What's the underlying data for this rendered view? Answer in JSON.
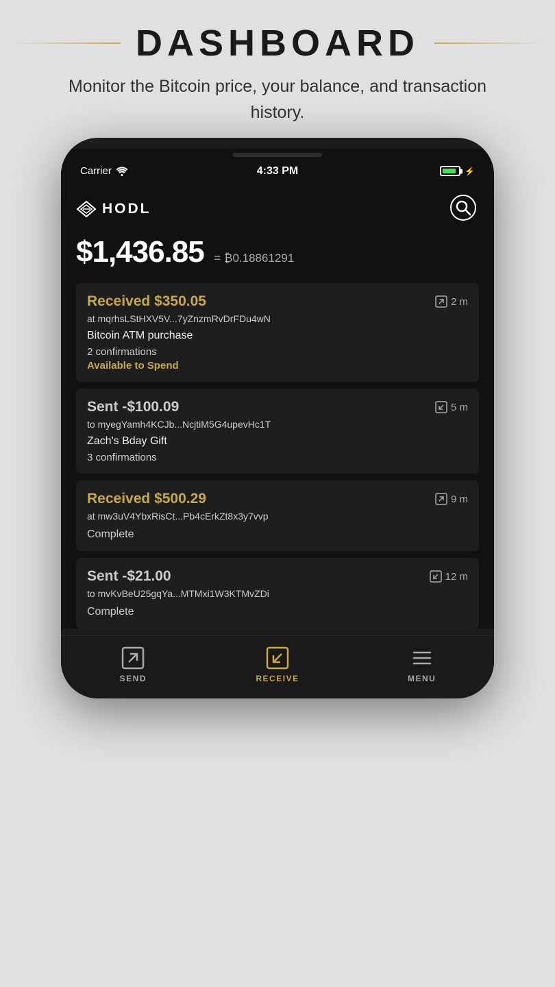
{
  "header": {
    "title": "DASHBOARD",
    "subtitle": "Monitor the Bitcoin price, your balance, and transaction history."
  },
  "phone": {
    "status_bar": {
      "carrier": "Carrier",
      "time": "4:33 PM",
      "battery_icon": "battery"
    },
    "app": {
      "logo_text": "HODL",
      "balance_usd": "$1,436.85",
      "balance_btc_prefix": "= ₿",
      "balance_btc": "0.18861291"
    },
    "transactions": [
      {
        "type": "received",
        "amount": "Received $350.05",
        "direction": "in",
        "address_prefix": "at",
        "address": "mqrhsLStHXV5V...7yZnzmRvDrFDu4wN",
        "label": "Bitcoin ATM purchase",
        "confirmations": "2 confirmations",
        "status": "Available to Spend",
        "status_type": "pending",
        "time": "2 m"
      },
      {
        "type": "sent",
        "amount": "Sent -$100.09",
        "direction": "out",
        "address_prefix": "to",
        "address": "myegYamh4KCJb...NcjtiM5G4upevHc1T",
        "label": "Zach's Bday Gift",
        "confirmations": "3 confirmations",
        "status": "",
        "status_type": "complete",
        "time": "5 m"
      },
      {
        "type": "received",
        "amount": "Received $500.29",
        "direction": "in",
        "address_prefix": "at",
        "address": "mw3uV4YbxRisCt...Pb4cErkZt8x3y7vvp",
        "label": "",
        "confirmations": "",
        "status": "Complete",
        "status_type": "complete",
        "time": "9 m"
      },
      {
        "type": "sent",
        "amount": "Sent -$21.00",
        "direction": "out",
        "address_prefix": "to",
        "address": "mvKvBeU25gqYa...MTMxi1W3KTMvZDi",
        "label": "",
        "confirmations": "",
        "status": "Complete",
        "status_type": "complete",
        "time": "12 m"
      }
    ],
    "nav": {
      "send_label": "SEND",
      "receive_label": "RECEIVE",
      "menu_label": "MENU"
    }
  }
}
